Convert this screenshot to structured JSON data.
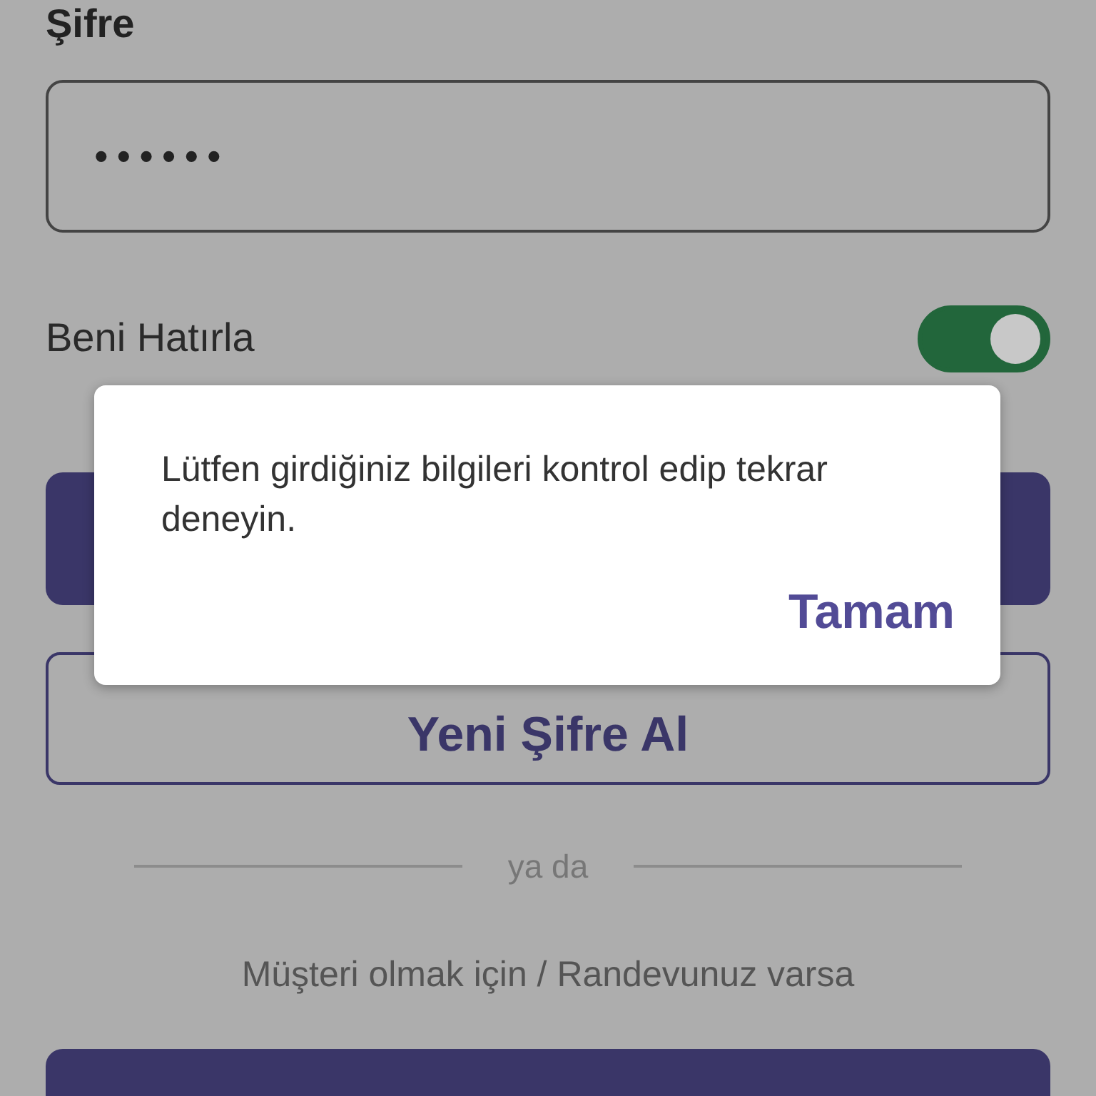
{
  "password_label": "Şifre",
  "password_field": {
    "value": "••••••"
  },
  "remember_me": {
    "label": "Beni Hatırla",
    "on": true
  },
  "new_password_button": "Yeni Şifre Al",
  "divider_text": "ya da",
  "customer_text": "Müşteri olmak için / Randevunuz varsa",
  "dialog": {
    "message": "Lütfen girdiğiniz bilgileri kontrol edip tekrar deneyin.",
    "button": "Tamam"
  }
}
